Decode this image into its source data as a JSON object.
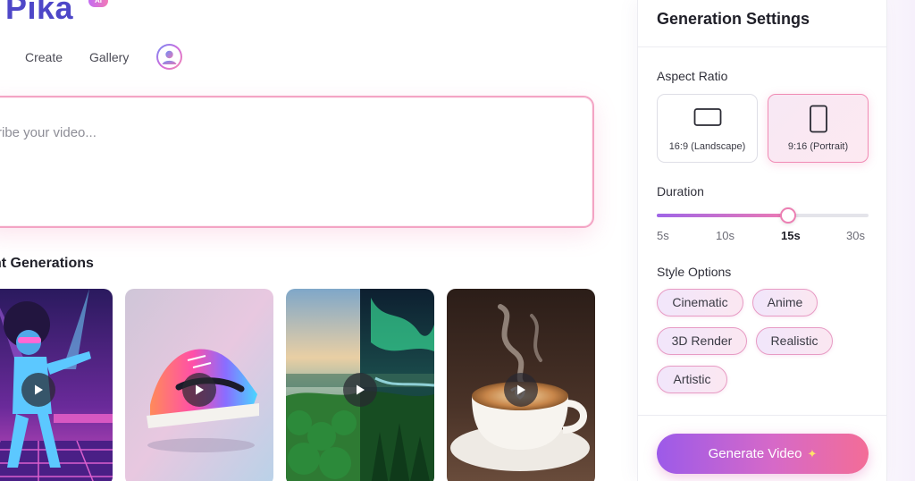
{
  "app": {
    "logo_text": "Pika",
    "logo_badge": "AI"
  },
  "nav": {
    "items": [
      {
        "label": "Create"
      },
      {
        "label": "Gallery"
      }
    ],
    "avatar_icon": "user-avatar-icon"
  },
  "prompt": {
    "placeholder": "scribe your video..."
  },
  "recent": {
    "title": "nt Generations",
    "items": [
      {
        "subject": "disco-dancer",
        "icon": "play-icon"
      },
      {
        "subject": "sneaker",
        "icon": "play-icon"
      },
      {
        "subject": "forest-aurora",
        "icon": "play-icon"
      },
      {
        "subject": "coffee-cup",
        "icon": "play-icon"
      }
    ]
  },
  "settings": {
    "title": "Generation Settings",
    "aspect_ratio": {
      "label": "Aspect Ratio",
      "options": [
        {
          "label": "16:9 (Landscape)",
          "selected": false,
          "icon": "landscape-icon"
        },
        {
          "label": "9:16 (Portrait)",
          "selected": true,
          "icon": "portrait-icon"
        }
      ]
    },
    "duration": {
      "label": "Duration",
      "ticks": [
        "5s",
        "10s",
        "15s",
        "30s"
      ],
      "selected": "15s",
      "slider_fraction": 0.62
    },
    "style": {
      "label": "Style Options",
      "options": [
        "Cinematic",
        "Anime",
        "3D Render",
        "Realistic",
        "Artistic"
      ]
    },
    "generate_button": {
      "label": "Generate Video",
      "icon": "sparkle-icon"
    }
  },
  "colors": {
    "brand": "#4e47c8",
    "accent_start": "#9c5ae9",
    "accent_end": "#f36d97",
    "selected_border": "#f08bb4"
  }
}
